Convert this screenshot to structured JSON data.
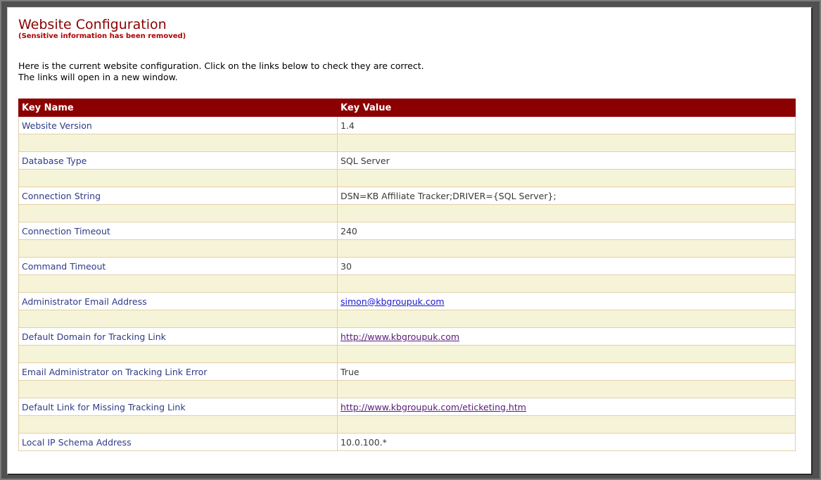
{
  "page": {
    "title": "Website Configuration",
    "subtitle": "(Sensitive information has been removed)",
    "intro_line1": "Here is the current website configuration.  Click on the links below to check they are correct.",
    "intro_line2": "The links will open in a new window."
  },
  "table": {
    "headers": [
      "Key Name",
      "Key Value"
    ],
    "rows": [
      {
        "key": "Website Version",
        "value": "1.4",
        "link": false
      },
      {
        "key": "Database Type",
        "value": "SQL Server",
        "link": false
      },
      {
        "key": "Connection String",
        "value": "DSN=KB Affiliate Tracker;DRIVER={SQL Server};",
        "link": false
      },
      {
        "key": "Connection Timeout",
        "value": "240",
        "link": false
      },
      {
        "key": "Command Timeout",
        "value": "30",
        "link": false
      },
      {
        "key": "Administrator Email Address",
        "value": "simon@kbgroupuk.com",
        "link": true,
        "visited": false
      },
      {
        "key": "Default Domain for Tracking Link",
        "value": "http://www.kbgroupuk.com",
        "link": true,
        "visited": true
      },
      {
        "key": "Email Administrator on Tracking Link Error",
        "value": "True",
        "link": false
      },
      {
        "key": "Default Link for Missing Tracking Link",
        "value": "http://www.kbgroupuk.com/eticketing.htm",
        "link": true,
        "visited": true
      },
      {
        "key": "Local IP Schema Address",
        "value": "10.0.100.*",
        "link": false
      }
    ]
  },
  "colors": {
    "header_bg": "#8b0000",
    "separator_bg": "#f6f4d8",
    "key_text": "#2e3b86"
  }
}
